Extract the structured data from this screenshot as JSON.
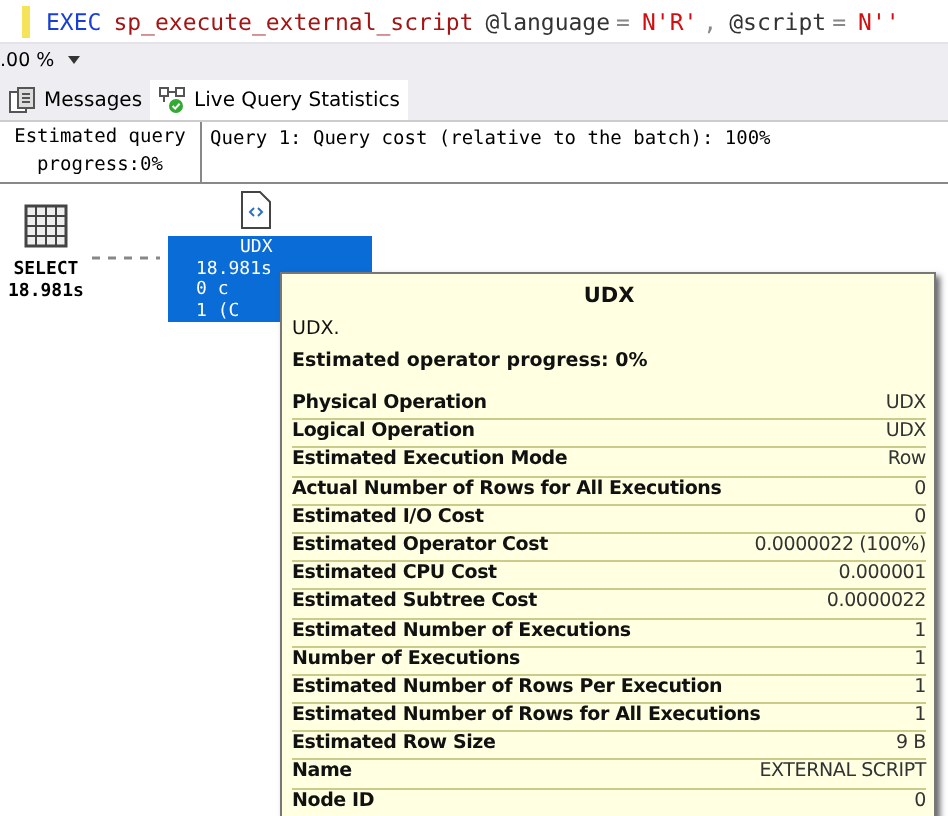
{
  "editor": {
    "keyword": "EXEC",
    "procedure": "sp_execute_external_script",
    "param1": "@language",
    "eq1": "=",
    "value1": "N'R'",
    "comma": ",",
    "param2": "@script",
    "eq2": "=",
    "value2": "N''"
  },
  "zoom": {
    "value": ".00 %"
  },
  "tabs": [
    {
      "label": "Messages",
      "selected": false,
      "kind": "messages"
    },
    {
      "label": "Live Query Statistics",
      "selected": true,
      "kind": "plan"
    }
  ],
  "query_header": {
    "progress": "Estimated query progress:0%",
    "text": "Query 1: Query cost (relative to the batch): 100%"
  },
  "plan": {
    "nodes": [
      {
        "kind": "select",
        "label": "SELECT",
        "time": "18.981s",
        "selected": false
      },
      {
        "kind": "udx",
        "label": "UDX",
        "time": "18.981s",
        "lines": [
          "0 c",
          "1 (C"
        ],
        "selected": true
      }
    ]
  },
  "tooltip": {
    "title": "UDX",
    "description": "UDX.",
    "progress": "Estimated operator progress: 0%",
    "rows": [
      {
        "name": "Physical Operation",
        "value": "UDX"
      },
      {
        "name": "Logical Operation",
        "value": "UDX"
      },
      {
        "name": "Estimated Execution Mode",
        "value": "Row"
      },
      {
        "name": "Actual Number of Rows for All Executions",
        "value": "0"
      },
      {
        "name": "Estimated I/O Cost",
        "value": "0"
      },
      {
        "name": "Estimated Operator Cost",
        "value": "0.0000022 (100%)"
      },
      {
        "name": "Estimated CPU Cost",
        "value": "0.000001"
      },
      {
        "name": "Estimated Subtree Cost",
        "value": "0.0000022"
      },
      {
        "name": "Estimated Number of Executions",
        "value": "1"
      },
      {
        "name": "Number of Executions",
        "value": "1"
      },
      {
        "name": "Estimated Number of Rows Per Execution",
        "value": "1"
      },
      {
        "name": "Estimated Number of Rows for All Executions",
        "value": "1"
      },
      {
        "name": "Estimated Row Size",
        "value": "9 B"
      },
      {
        "name": "Name",
        "value": "EXTERNAL SCRIPT"
      },
      {
        "name": "Node ID",
        "value": "0"
      }
    ]
  }
}
